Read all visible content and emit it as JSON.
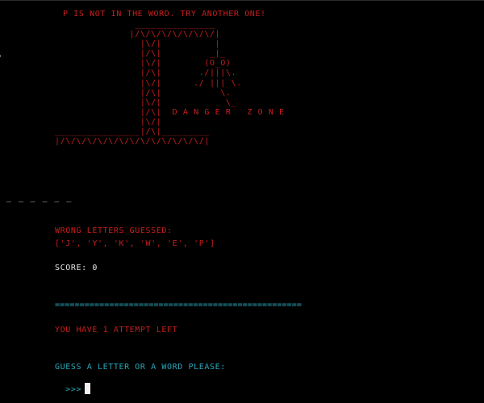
{
  "colors": {
    "background": "#000000",
    "error_text": "#c81e1e",
    "normal_text": "#e6e6e6",
    "prompt_text": "#2aa8b8"
  },
  "game": {
    "message": "P IS NOT IN THE WORD. TRY ANOTHER ONE!",
    "gallows_art": "               _______________\n              |/\\/\\/\\/\\/\\/\\/\\/|\n                |\\/|          |\n                |/\\|         _|_\n                |\\/|        (O_O)\n                |/\\|       ./|||\\.\n                |\\/|      ./ ||| \\.\n                |/\\|           \\.\n                |\\/|            \\_\n                |/\\|  D A N G E R   Z O N E\n                |\\/|\n________________|/\\|_________\n|/\\/\\/\\/\\/\\/\\/\\/\\/\\/\\/\\/\\/\\/|",
    "word_progress": "_ _ _ _ _ _",
    "wrong_letters_heading": "WRONG LETTERS GUESSED:",
    "wrong_letters": "['J', 'Y', 'K', 'W', 'E', 'P']",
    "score_text": "SCORE: 0",
    "separator": "==================================================",
    "attempts_text": "YOU HAVE 1 ATTEMPT LEFT",
    "input_prompt": "GUESS A LETTER OR A WORD PLEASE:",
    "input_marker": ">>>",
    "input_value": ""
  }
}
